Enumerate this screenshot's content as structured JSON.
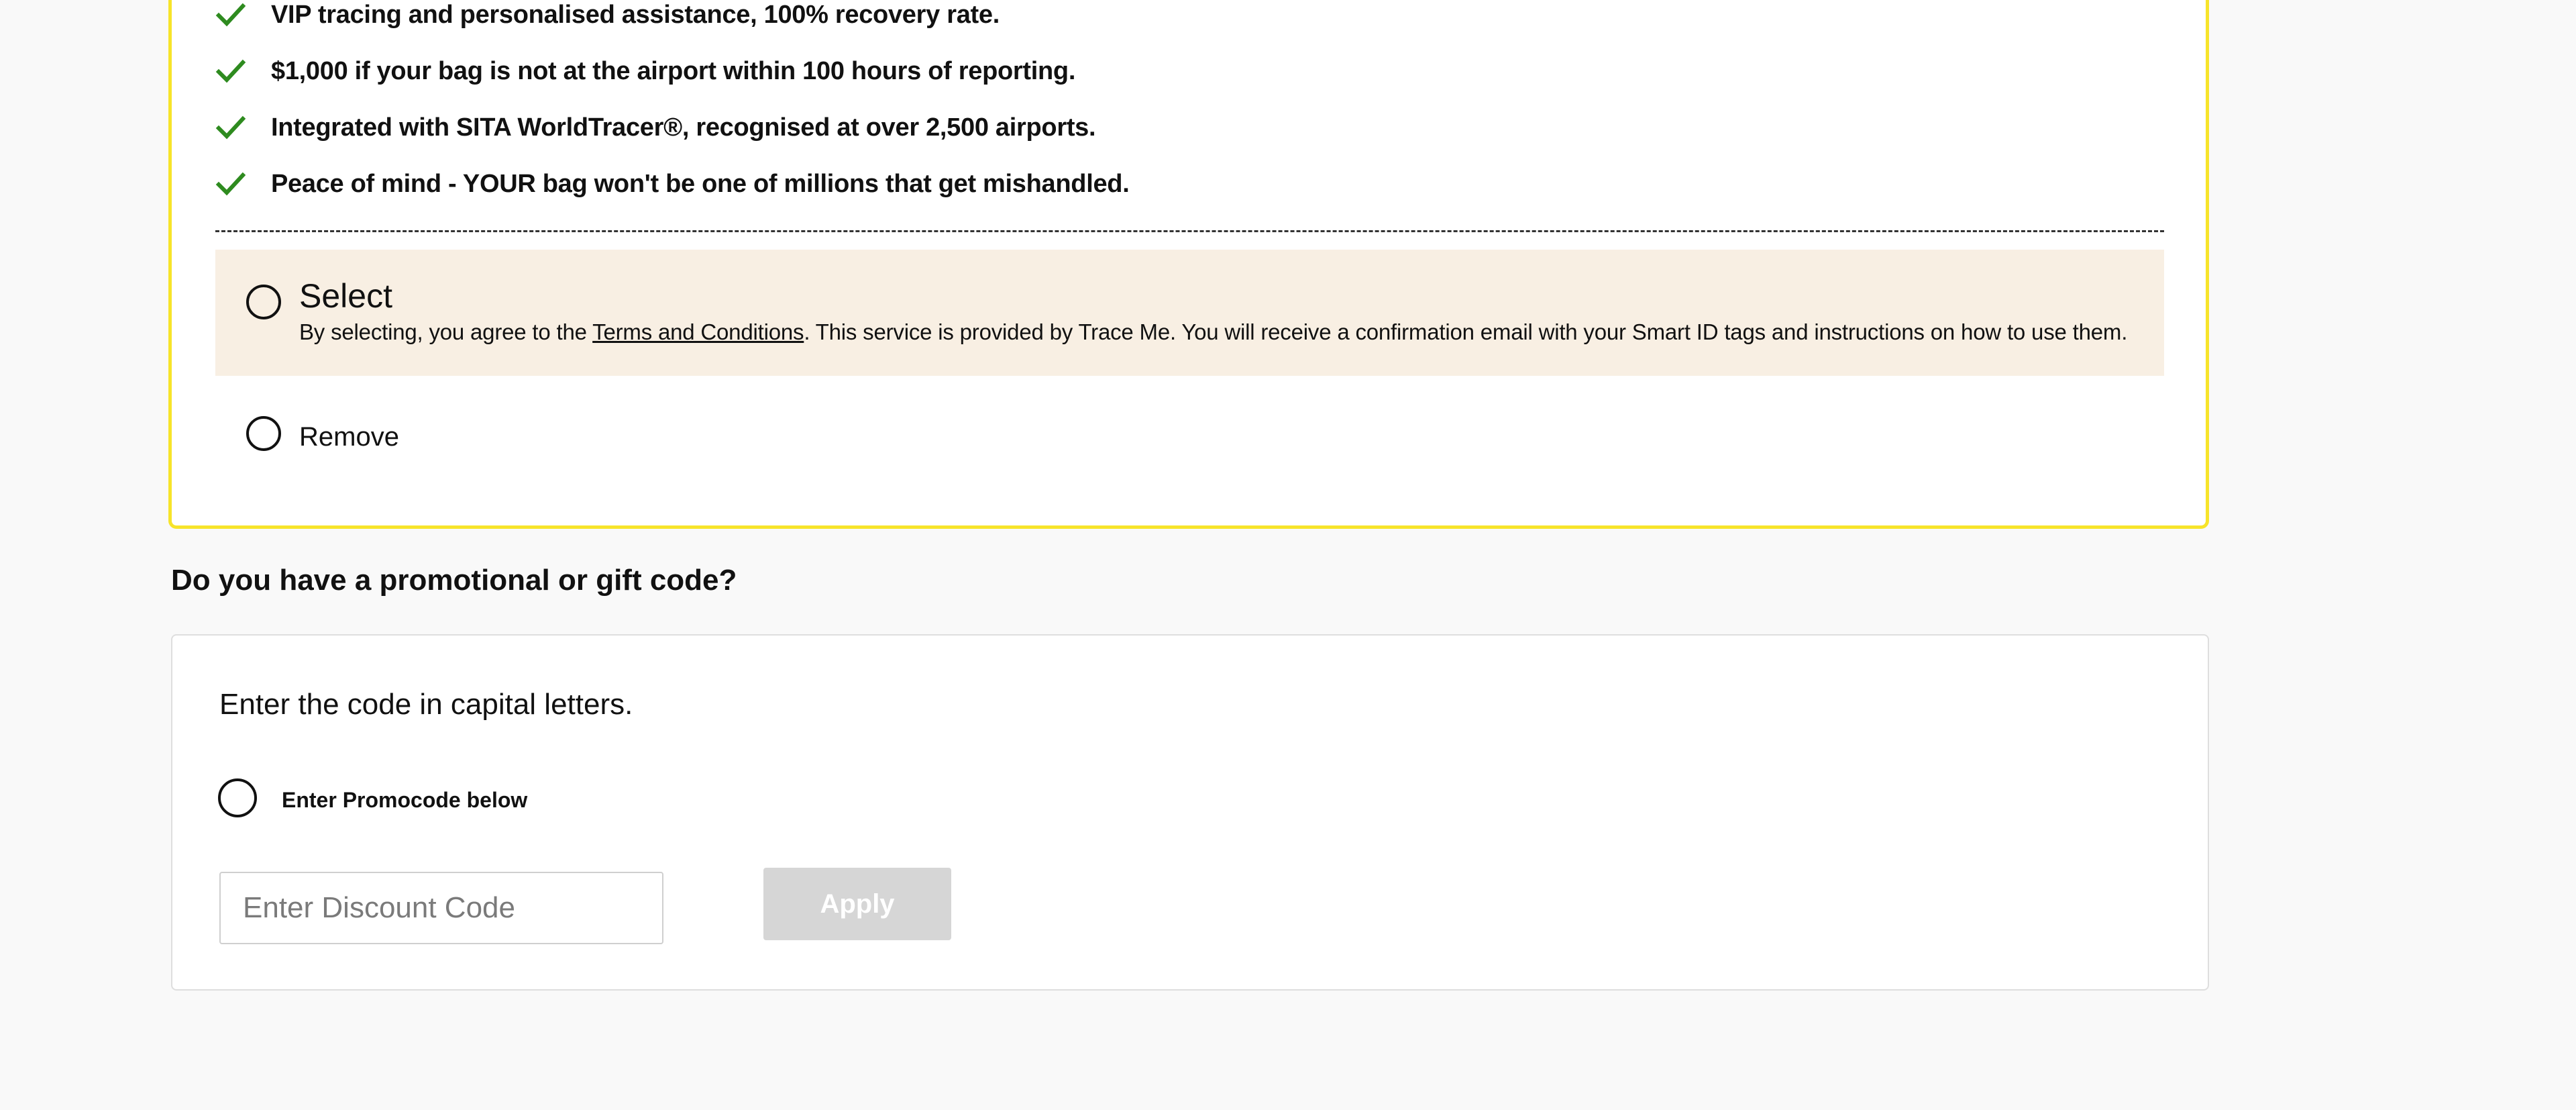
{
  "protection": {
    "benefits": [
      "VIP tracing and personalised assistance, 100% recovery rate.",
      "$1,000 if your bag is not at the airport within 100 hours of reporting.",
      "Integrated with SITA WorldTracer®, recognised at over 2,500 airports.",
      "Peace of mind - YOUR bag won't be one of millions that get mishandled."
    ],
    "select": {
      "title": "Select",
      "desc_before": "By selecting, you agree to the ",
      "terms_link": "Terms and Conditions",
      "desc_after": ". This service is provided by Trace Me. You will receive a confirmation email with your Smart ID tags and instructions on how to use them."
    },
    "remove_label": "Remove",
    "check_color": "#2e8b1f",
    "accent_border_color": "#f7e42a"
  },
  "promo": {
    "heading": "Do you have a promotional or gift code?",
    "instruction": "Enter the code in capital letters.",
    "option_label": "Enter Promocode below",
    "input_placeholder": "Enter Discount Code",
    "input_value": "",
    "apply_label": "Apply"
  }
}
